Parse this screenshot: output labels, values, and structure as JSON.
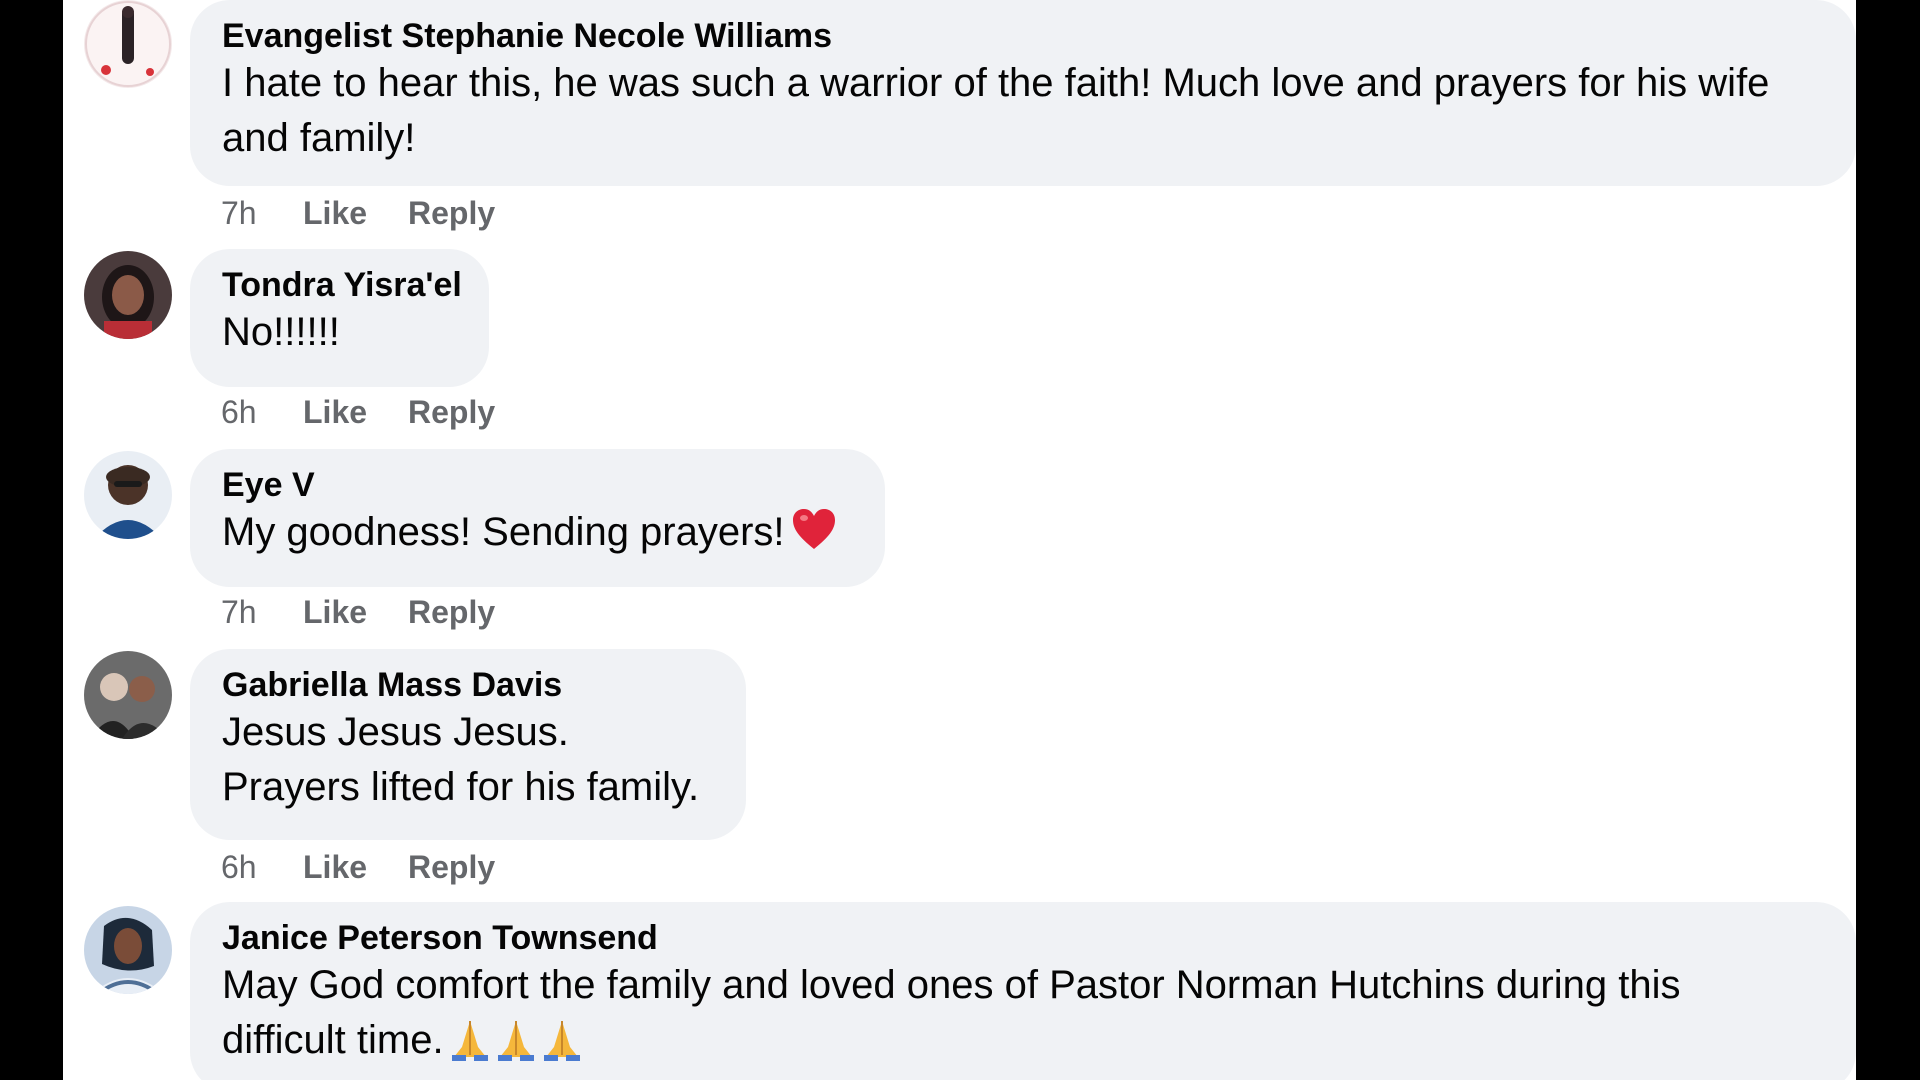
{
  "comments": [
    {
      "author": "Evangelist Stephanie Necole Williams",
      "text": "I hate to hear this, he was such a warrior of the faith! Much love and prayers for his wife\nand family!",
      "time": "7h",
      "like": "Like",
      "reply": "Reply",
      "avatar": "avatar-photo"
    },
    {
      "author": "Tondra Yisra'el",
      "text": "No!!!!!!",
      "time": "6h",
      "like": "Like",
      "reply": "Reply",
      "avatar": "avatar-photo"
    },
    {
      "author": "Eye V",
      "text": "My goodness! Sending prayers!",
      "emoji": "red-heart-icon",
      "time": "7h",
      "like": "Like",
      "reply": "Reply",
      "avatar": "avatar-photo"
    },
    {
      "author": "Gabriella Mass Davis",
      "text": "Jesus Jesus Jesus.\nPrayers lifted for his family.",
      "time": "6h",
      "like": "Like",
      "reply": "Reply",
      "avatar": "avatar-photo"
    },
    {
      "author": "Janice Peterson Townsend",
      "text": "May God comfort the family and loved ones of Pastor Norman Hutchins during this\ndifficult time.",
      "emoji": "folded-hands-icon",
      "time": "",
      "like": "",
      "reply": "",
      "avatar": "avatar-photo"
    }
  ],
  "colors": {
    "bubble": "#f0f2f5",
    "text": "#050505",
    "meta": "#65676b",
    "heart": "#e0233a",
    "pray": "#f5b73b"
  }
}
